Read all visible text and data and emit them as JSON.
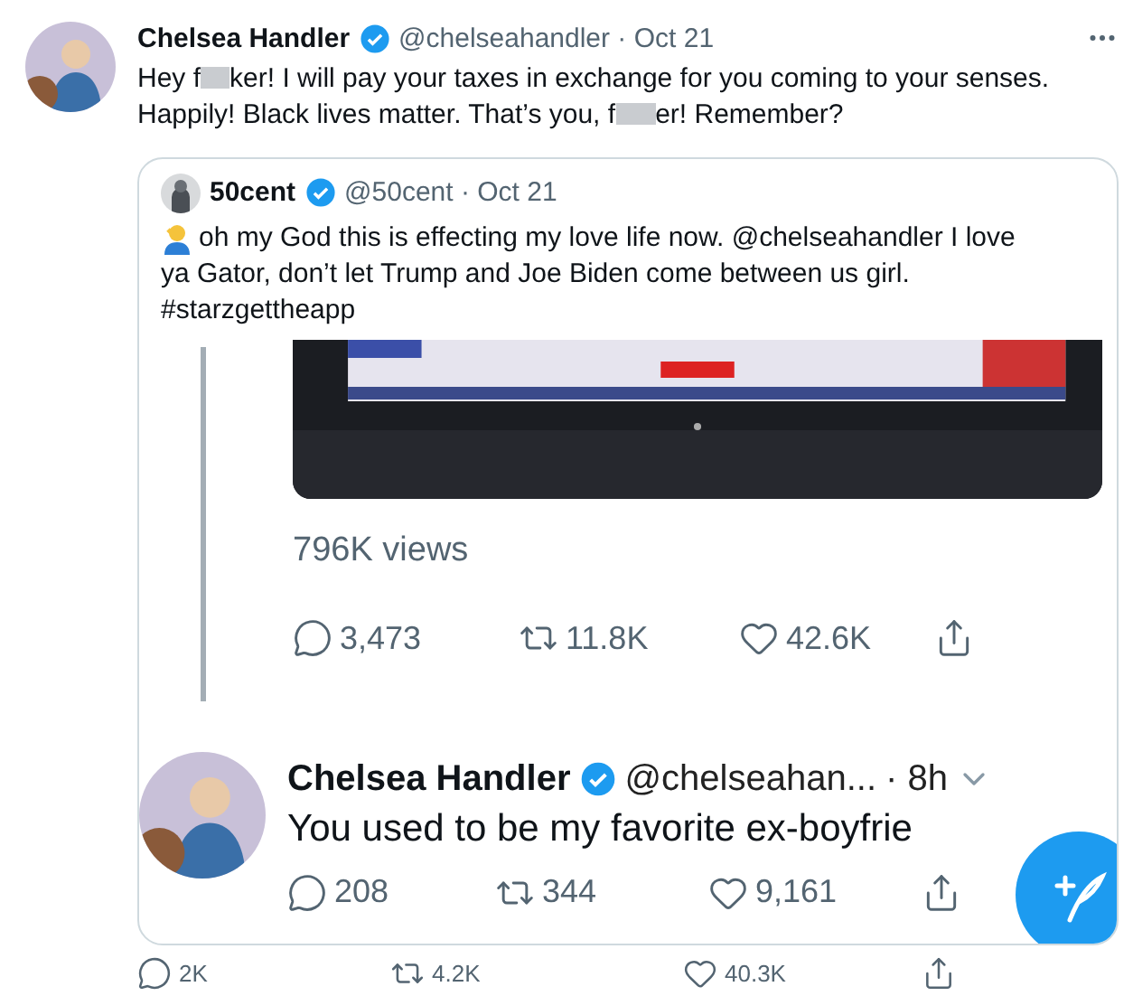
{
  "tweet": {
    "name": "Chelsea Handler",
    "verified": true,
    "meta": "@chelseahandler · Oct 21",
    "lines": [
      [
        {
          "kind": "text",
          "text": "Hey f"
        },
        {
          "kind": "censor"
        },
        {
          "kind": "text",
          "text": "ker! I will pay your taxes in exchange for you coming to your senses."
        }
      ],
      [
        {
          "kind": "text",
          "text": "Happily! Black lives matter. That’s you, f"
        },
        {
          "kind": "censor"
        },
        {
          "kind": "text",
          "text": "er! Remember?"
        }
      ]
    ],
    "quote": {
      "name": "50cent",
      "verified": true,
      "meta": "@50cent · Oct 21",
      "lines": [
        "oh my God this is effecting my love life now. @chelseahandler I love",
        "ya Gator, don’t let Trump and Joe Biden come between us girl.",
        "#starzgettheapp"
      ],
      "views": "796K views",
      "actions": [
        {
          "kind": "reply",
          "count": "3,473"
        },
        {
          "kind": "retweet",
          "count": "11.8K"
        },
        {
          "kind": "like",
          "count": "42.6K"
        },
        {
          "kind": "share"
        }
      ],
      "reply": {
        "name": "Chelsea Handler",
        "verified": true,
        "handle": "@chelseahan...",
        "time": "· 8h",
        "text": "You used to be my favorite ex-boyfrie",
        "actions": [
          {
            "kind": "reply",
            "count": "208"
          },
          {
            "kind": "retweet",
            "count": "344"
          },
          {
            "kind": "like",
            "count": "9,161"
          },
          {
            "kind": "share"
          }
        ]
      }
    },
    "actions": [
      {
        "kind": "reply",
        "count": "2K"
      },
      {
        "kind": "retweet",
        "count": "4.2K"
      },
      {
        "kind": "like",
        "count": "40.3K"
      },
      {
        "kind": "share"
      }
    ]
  }
}
